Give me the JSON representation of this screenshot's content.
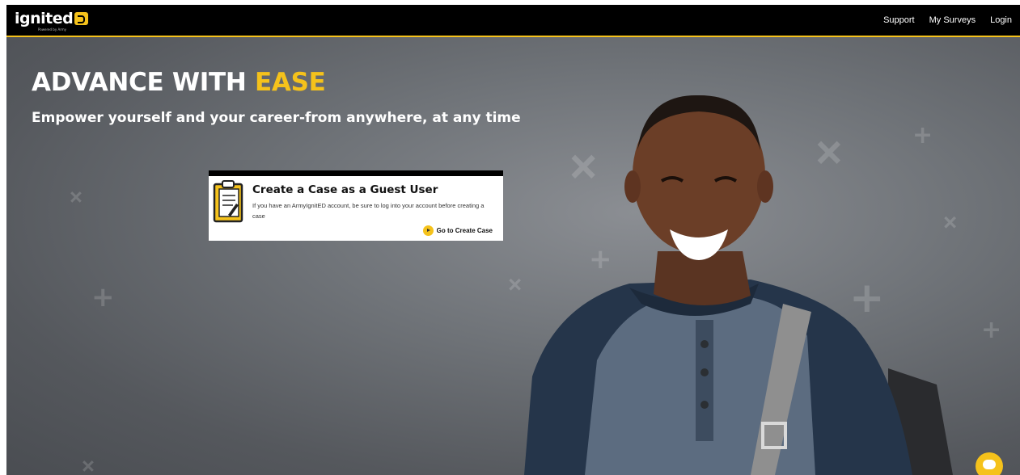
{
  "brand": {
    "logo_text": "ignited",
    "logo_subtext": "Powered by Army"
  },
  "nav": {
    "links": [
      "Support",
      "My Surveys",
      "Login"
    ]
  },
  "hero": {
    "title_main": "ADVANCE WITH",
    "title_accent": "EASE",
    "subtitle": "Empower yourself and your career-from anywhere, at any time"
  },
  "card": {
    "title": "Create a Case as a Guest User",
    "description": "If you have an ArmyIgnitED account, be sure to log into your account before creating a case",
    "link_label": "Go to Create Case",
    "icon": "clipboard-icon"
  },
  "chat": {
    "icon": "chat-icon"
  },
  "colors": {
    "accent": "#f5c21b",
    "navbar": "#000000",
    "hero_bg": "#6f7378"
  }
}
